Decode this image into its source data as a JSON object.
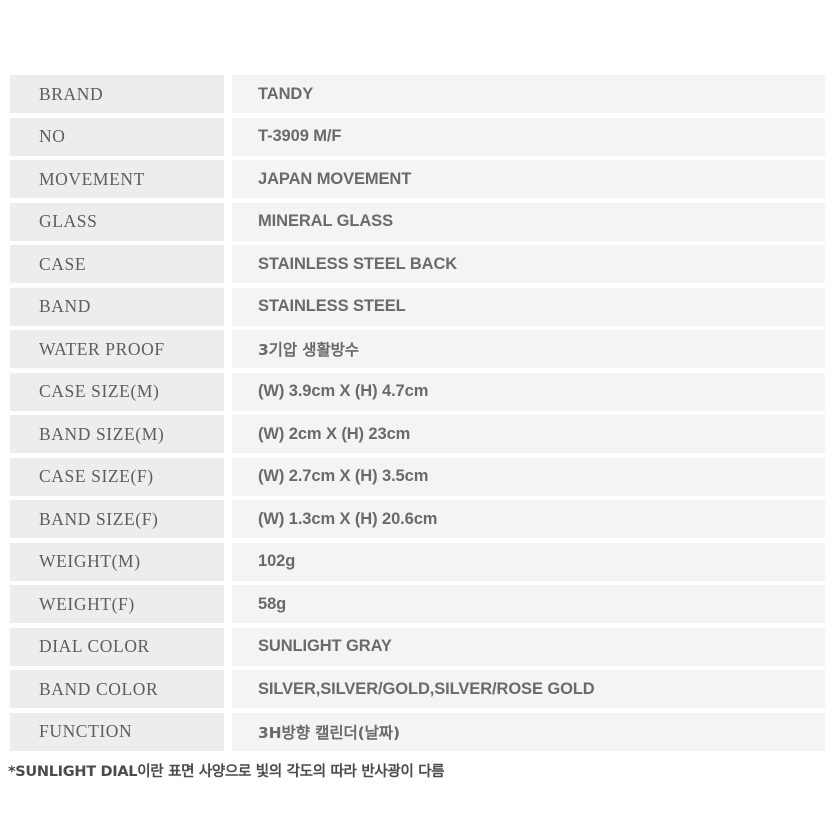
{
  "spec_table": {
    "rows": [
      {
        "label": "BRAND",
        "value": "TANDY",
        "korean": false
      },
      {
        "label": "NO",
        "value": "T-3909 M/F",
        "korean": false
      },
      {
        "label": "MOVEMENT",
        "value": "JAPAN MOVEMENT",
        "korean": false
      },
      {
        "label": "GLASS",
        "value": "MINERAL GLASS",
        "korean": false
      },
      {
        "label": "CASE",
        "value": "STAINLESS STEEL BACK",
        "korean": false
      },
      {
        "label": "BAND",
        "value": "STAINLESS STEEL",
        "korean": false
      },
      {
        "label": "WATER PROOF",
        "value": "3기압 생활방수",
        "korean": true
      },
      {
        "label": "CASE SIZE(M)",
        "value": "(W) 3.9cm X (H) 4.7cm",
        "korean": false
      },
      {
        "label": "BAND SIZE(M)",
        "value": "(W) 2cm X (H) 23cm",
        "korean": false
      },
      {
        "label": "CASE SIZE(F)",
        "value": "(W) 2.7cm X (H) 3.5cm",
        "korean": false
      },
      {
        "label": "BAND SIZE(F)",
        "value": "(W) 1.3cm X (H) 20.6cm",
        "korean": false
      },
      {
        "label": "WEIGHT(M)",
        "value": "102g",
        "korean": false
      },
      {
        "label": "WEIGHT(F)",
        "value": "58g",
        "korean": false
      },
      {
        "label": "DIAL COLOR",
        "value": "SUNLIGHT GRAY",
        "korean": false
      },
      {
        "label": "BAND COLOR",
        "value": "SILVER,SILVER/GOLD,SILVER/ROSE GOLD",
        "korean": false
      },
      {
        "label": "FUNCTION",
        "value": "3H방향 캘린더(날짜)",
        "korean": true
      }
    ]
  },
  "footnote": {
    "text": "*SUNLIGHT DIAL이란 표면 사양으로 빛의 각도의 따라 반사광이 다름"
  },
  "colors": {
    "page_background": "#ffffff",
    "label_cell_background": "#ededed",
    "value_cell_background": "#f4f4f4",
    "label_text": "#5d5d5d",
    "value_text": "#6a6a6a",
    "footnote_text": "#4a4a4a"
  }
}
